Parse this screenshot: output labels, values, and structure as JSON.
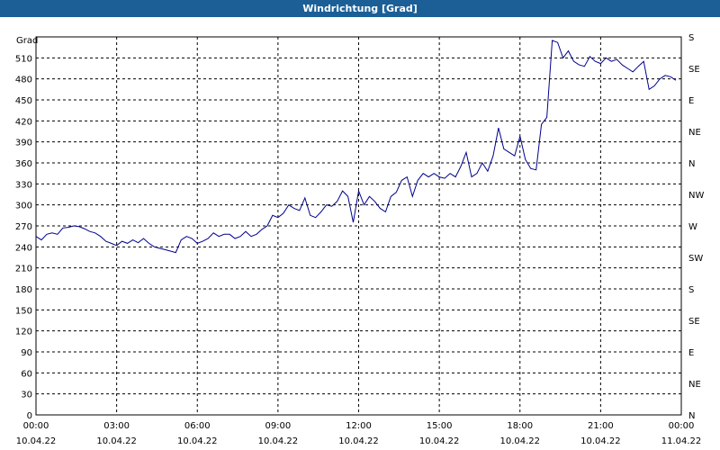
{
  "window": {
    "title": "Windrichtung [Grad]"
  },
  "chart_data": {
    "type": "line",
    "title": "Windrichtung [Grad]",
    "ylabel": "Grad",
    "ylim": [
      0,
      540
    ],
    "yticks": [
      0,
      30,
      60,
      90,
      120,
      150,
      180,
      210,
      240,
      270,
      300,
      330,
      360,
      390,
      420,
      450,
      480,
      510
    ],
    "xlim": [
      "10.04.22 00:00",
      "11.04.22 00:00"
    ],
    "xticks": [
      {
        "time": "00:00",
        "date": "10.04.22",
        "hour": 0
      },
      {
        "time": "03:00",
        "date": "10.04.22",
        "hour": 3
      },
      {
        "time": "06:00",
        "date": "10.04.22",
        "hour": 6
      },
      {
        "time": "09:00",
        "date": "10.04.22",
        "hour": 9
      },
      {
        "time": "12:00",
        "date": "10.04.22",
        "hour": 12
      },
      {
        "time": "15:00",
        "date": "10.04.22",
        "hour": 15
      },
      {
        "time": "18:00",
        "date": "10.04.22",
        "hour": 18
      },
      {
        "time": "21:00",
        "date": "10.04.22",
        "hour": 21
      },
      {
        "time": "00:00",
        "date": "11.04.22",
        "hour": 24
      }
    ],
    "y2ticks": [
      {
        "label": "N",
        "value": 0
      },
      {
        "label": "NE",
        "value": 45
      },
      {
        "label": "E",
        "value": 90
      },
      {
        "label": "SE",
        "value": 135
      },
      {
        "label": "S",
        "value": 180
      },
      {
        "label": "SW",
        "value": 225
      },
      {
        "label": "W",
        "value": 270
      },
      {
        "label": "NW",
        "value": 315
      },
      {
        "label": "N",
        "value": 360
      },
      {
        "label": "NE",
        "value": 405
      },
      {
        "label": "E",
        "value": 450
      },
      {
        "label": "SE",
        "value": 495
      },
      {
        "label": "S",
        "value": 540
      }
    ],
    "grid": true,
    "line_color": "#00008b",
    "series": [
      {
        "x": [
          0.0,
          0.2,
          0.4,
          0.6,
          0.8,
          1.0,
          1.2,
          1.4,
          1.6,
          1.8,
          2.0,
          2.2,
          2.4,
          2.6,
          2.8,
          3.0,
          3.2,
          3.4,
          3.6,
          3.8,
          4.0,
          4.2,
          4.4,
          4.6,
          4.8,
          5.0,
          5.2,
          5.4,
          5.6,
          5.8,
          6.0,
          6.2,
          6.4,
          6.6,
          6.8,
          7.0,
          7.2,
          7.4,
          7.6,
          7.8,
          8.0,
          8.2,
          8.4,
          8.6,
          8.8,
          9.0,
          9.2,
          9.4,
          9.6,
          9.8,
          10.0,
          10.2,
          10.4,
          10.6,
          10.8,
          11.0,
          11.2,
          11.4,
          11.6,
          11.8,
          12.0,
          12.2,
          12.4,
          12.6,
          12.8,
          13.0,
          13.2,
          13.4,
          13.6,
          13.8,
          14.0,
          14.2,
          14.4,
          14.6,
          14.8,
          15.0,
          15.2,
          15.4,
          15.6,
          15.8,
          16.0,
          16.2,
          16.4,
          16.6,
          16.8,
          17.0,
          17.2,
          17.4,
          17.6,
          17.8,
          18.0,
          18.2,
          18.4,
          18.6,
          18.8,
          19.0,
          19.2,
          19.4,
          19.6,
          19.8,
          20.0,
          20.2,
          20.4,
          20.6,
          20.8,
          21.0,
          21.2,
          21.4,
          21.6,
          21.8,
          22.0,
          22.2,
          22.4,
          22.6,
          22.8,
          23.0,
          23.2,
          23.4,
          23.6,
          23.8
        ],
        "y": [
          255,
          250,
          258,
          260,
          258,
          267,
          268,
          270,
          269,
          266,
          262,
          260,
          255,
          248,
          245,
          242,
          248,
          245,
          250,
          246,
          252,
          245,
          240,
          238,
          236,
          234,
          232,
          250,
          255,
          252,
          245,
          248,
          252,
          260,
          255,
          258,
          258,
          252,
          255,
          262,
          255,
          258,
          265,
          270,
          285,
          282,
          288,
          300,
          295,
          292,
          310,
          285,
          282,
          290,
          300,
          298,
          305,
          320,
          312,
          275,
          320,
          300,
          312,
          305,
          295,
          290,
          312,
          318,
          335,
          340,
          312,
          335,
          345,
          340,
          345,
          340,
          338,
          345,
          340,
          355,
          375,
          340,
          345,
          360,
          348,
          370,
          410,
          380,
          375,
          370,
          398,
          365,
          352,
          350,
          415,
          425,
          535,
          532,
          510,
          520,
          505,
          500,
          498,
          512,
          505,
          502,
          510,
          505,
          508,
          500,
          495,
          490,
          498,
          505,
          465,
          470,
          480,
          485,
          483,
          478
        ]
      }
    ]
  }
}
